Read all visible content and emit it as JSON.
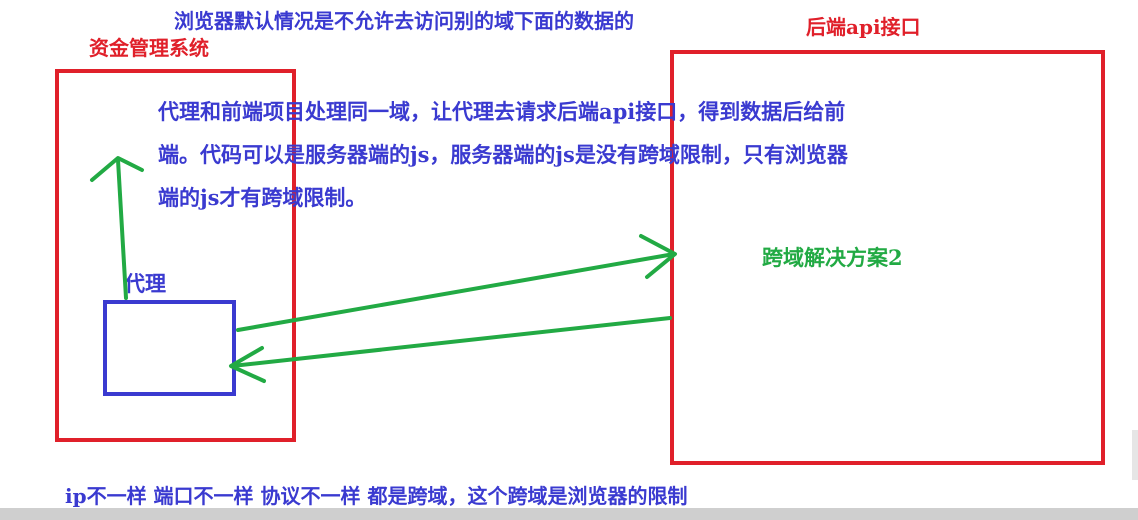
{
  "texts": {
    "header_note": "浏览器默认情况是不允许去访问别的域下面的数据的",
    "backend_label": "后端api接口",
    "system_label": "资金管理系统",
    "explanation_line1": "代理和前端项目处理同一域，让代理去请求后端api接口，得到数据后给前",
    "explanation_line2": "端。代码可以是服务器端的js，服务器端的js是没有跨域限制，只有浏览器",
    "explanation_line3": "端的js才有跨域限制。",
    "proxy_label": "代理",
    "solution_label": "跨域解决方案2",
    "footer_note": "ip不一样  端口不一样   协议不一样 都是跨域，这个跨域是浏览器的限制"
  },
  "colors": {
    "red": "#e0202a",
    "blue": "#3a3ad0",
    "green": "#22aa44"
  }
}
